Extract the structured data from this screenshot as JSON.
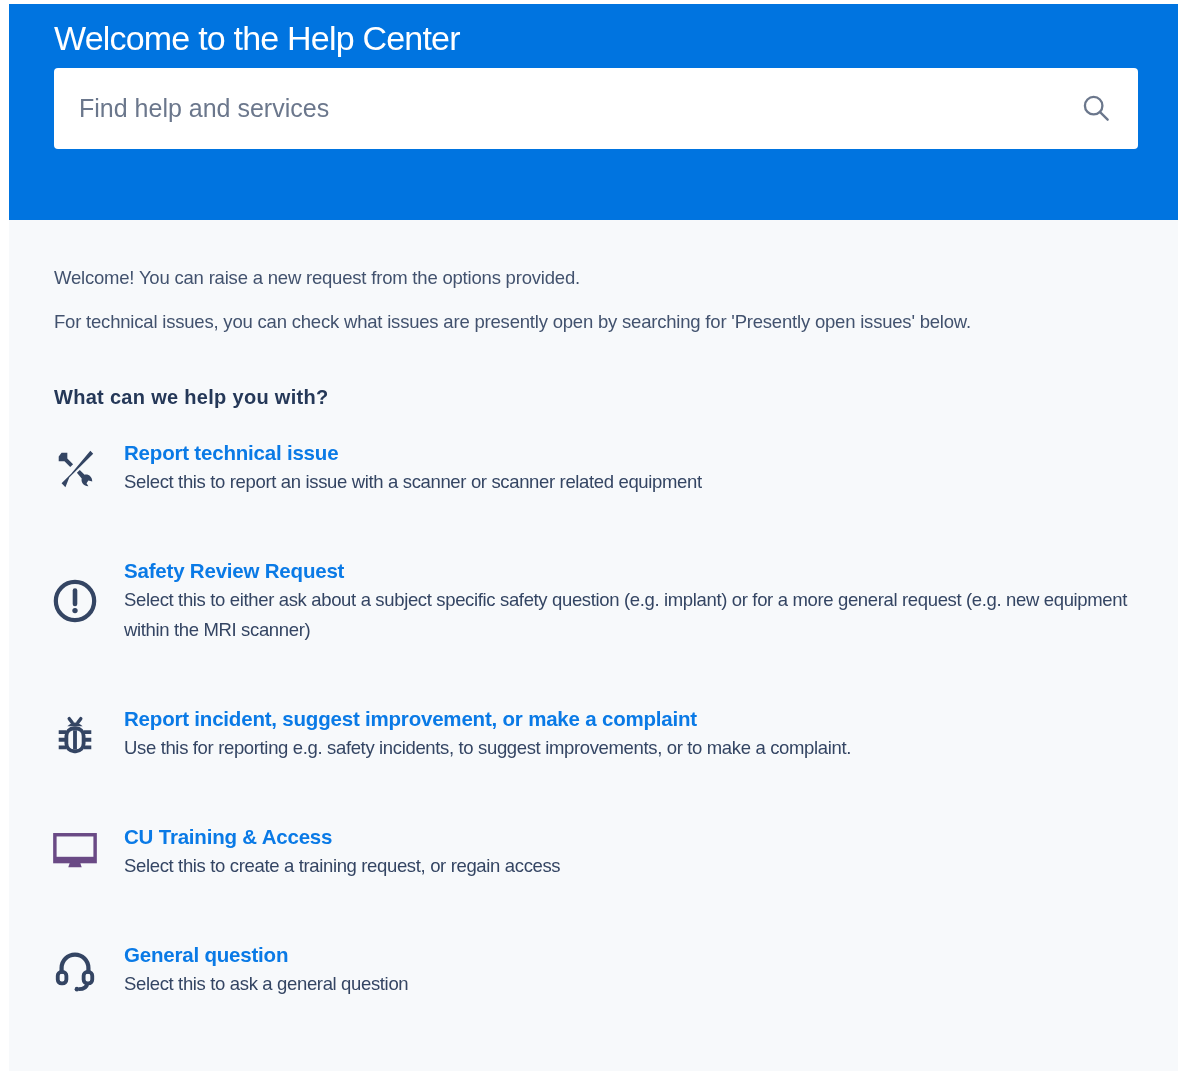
{
  "header": {
    "title": "Welcome to the Help Center",
    "search": {
      "placeholder": "Find help and services"
    }
  },
  "intro": [
    "Welcome! You can raise a new request from the options provided.",
    "For technical issues, you can check what issues are presently open by searching for 'Presently open issues' below."
  ],
  "section_heading": "What can we help you with?",
  "request_types": [
    {
      "kind": "tools",
      "title": "Report technical issue",
      "description": "Select this to report an issue with a scanner or scanner related equipment"
    },
    {
      "kind": "alert",
      "title": "Safety Review Request",
      "description": "Select this to either ask about a subject specific safety question (e.g. implant) or for a more general request (e.g. new equipment within the MRI scanner)"
    },
    {
      "kind": "bug",
      "title": "Report incident, suggest improvement, or make a complaint",
      "description": "Use this for reporting e.g. safety incidents, to suggest improvements, or to make a complaint."
    },
    {
      "kind": "monitor",
      "title": "CU Training & Access",
      "description": "Select this to create a training request, or regain access"
    },
    {
      "kind": "headset",
      "title": "General question",
      "description": "Select this to ask a general question"
    }
  ]
}
